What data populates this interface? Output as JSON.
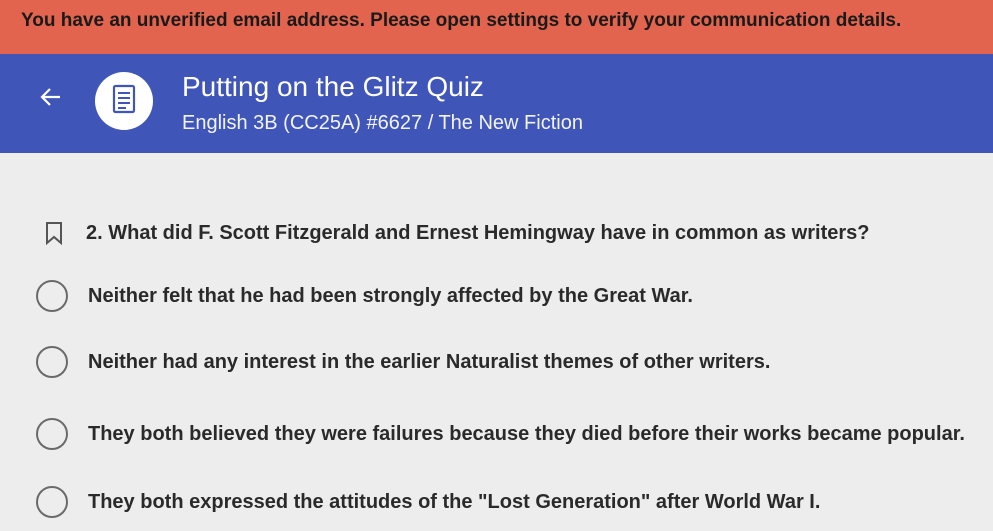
{
  "banner": {
    "message": "You have an unverified email address. Please open settings to verify your communication details."
  },
  "header": {
    "back_icon": "arrow-left-icon",
    "quiz_icon": "list-document-icon",
    "title": "Putting on the Glitz Quiz",
    "subtitle": "English 3B (CC25A) #6627 / The New Fiction"
  },
  "question": {
    "bookmark_icon": "bookmark-icon",
    "text": "2. What did F. Scott Fitzgerald and Ernest Hemingway have in common as writers?"
  },
  "options": [
    {
      "label": "Neither felt that he had been strongly affected by the Great War."
    },
    {
      "label": "Neither had any interest in the earlier Naturalist themes of other writers."
    },
    {
      "label": "They both believed they were failures because they died before their works became popular."
    },
    {
      "label": "They both expressed the attitudes of the \"Lost Generation\" after World War I."
    }
  ],
  "colors": {
    "banner": "#e2644f",
    "header": "#3f55b8",
    "background": "#ededed"
  }
}
